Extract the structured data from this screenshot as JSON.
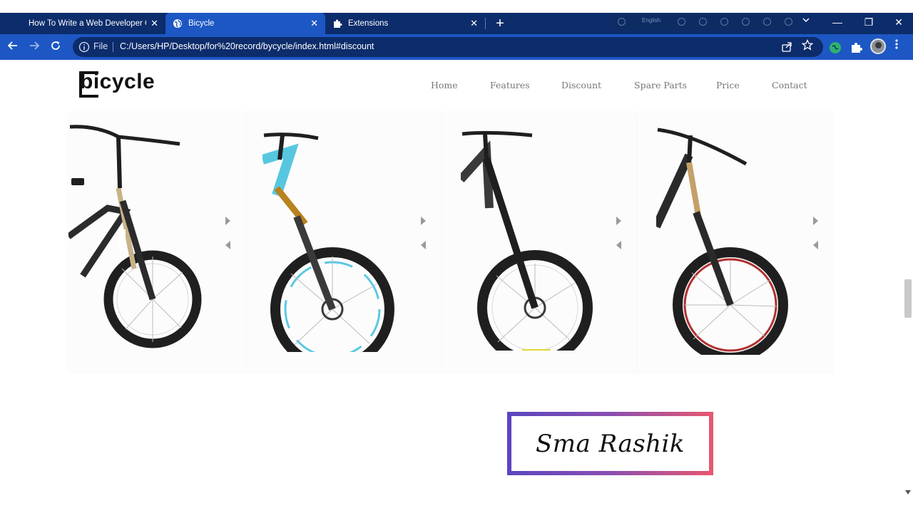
{
  "browser": {
    "tabs": [
      {
        "title": "How To Write a Web Developer C",
        "active": false,
        "icon": "website-favicon"
      },
      {
        "title": "Bicycle",
        "active": true,
        "icon": "globe-icon"
      },
      {
        "title": "Extensions",
        "active": false,
        "icon": "puzzle-icon"
      }
    ],
    "new_tab": "+",
    "close_glyph": "✕",
    "screen_toolbar": {
      "language": "English"
    },
    "address": {
      "scheme_label": "File",
      "url": "C:/Users/HP/Desktop/for%20record/bycycle/index.html#discount"
    },
    "window_controls": {
      "minimize": "—",
      "restore": "❐",
      "close": "✕"
    }
  },
  "site": {
    "logo": "bicycle",
    "nav": [
      "Home",
      "Features",
      "Discount",
      "Spare Parts",
      "Price",
      "Contact"
    ],
    "accent_color": "#111111"
  },
  "cards": [
    {
      "name": "dirt-jump-bike",
      "frame_color": "#2b2b2b",
      "fork_color": "#c9b28a",
      "rim_color": "#1f1f1f",
      "accent": "#ffffff"
    },
    {
      "name": "downhill-bike",
      "frame_color": "#57c7e0",
      "fork_color": "#b8821f",
      "rim_color": "#1f1f1f",
      "accent": "#5cc8e6"
    },
    {
      "name": "enduro-bike",
      "frame_color": "#3a3a3a",
      "fork_color": "#1f1f1f",
      "rim_color": "#1f1f1f",
      "accent": "#e3d83a"
    },
    {
      "name": "trail-bike",
      "frame_color": "#2a2a2a",
      "fork_color": "#c4a06a",
      "rim_color": "#2a1a1a",
      "accent": "#b03030"
    }
  ],
  "watermark": {
    "text": "Sma Rashik",
    "gradient": [
      "#5b45c0",
      "#e8576f"
    ]
  }
}
